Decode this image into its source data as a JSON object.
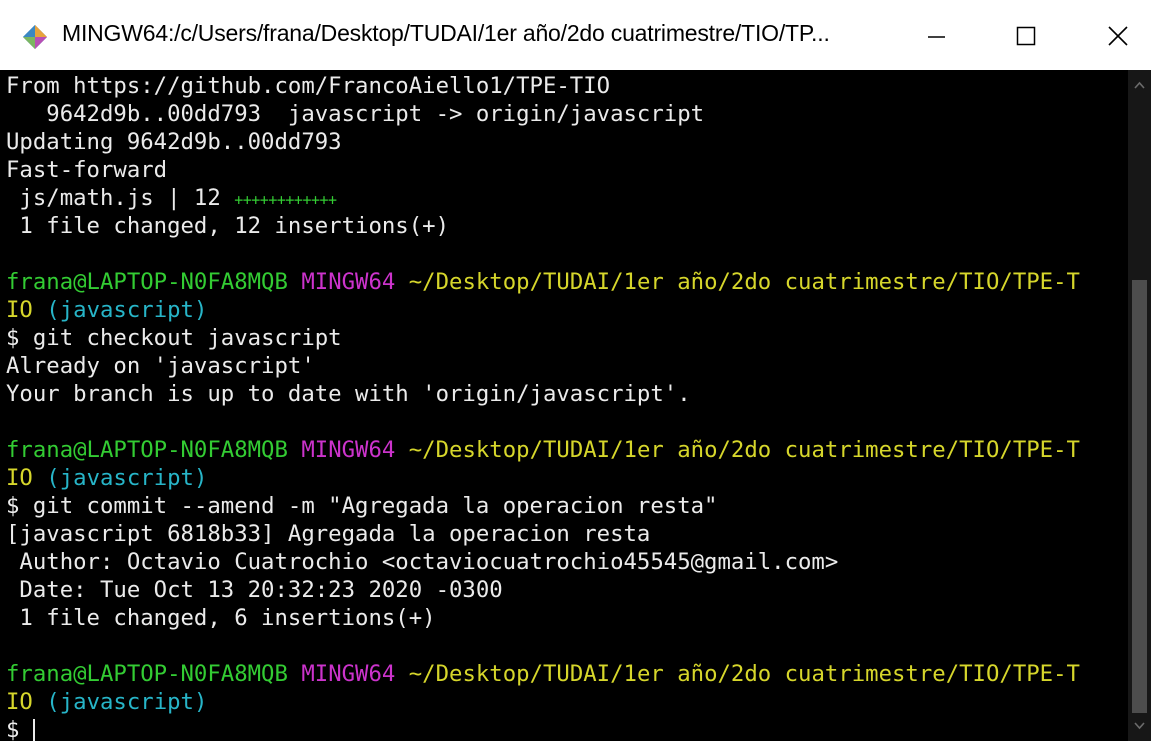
{
  "window": {
    "title": "MINGW64:/c/Users/frana/Desktop/TUDAI/1er año/2do cuatrimestre/TIO/TP...",
    "app_icon": "mingw-diamond-icon",
    "controls": {
      "minimize_icon": "minimize-icon",
      "maximize_icon": "maximize-icon",
      "close_icon": "close-icon"
    }
  },
  "colors": {
    "background": "#000000",
    "text": "#ebebeb",
    "user_host": "#33cc33",
    "mingw": "#cc33cc",
    "path": "#d6d62b",
    "branch": "#27b5c8"
  },
  "terminal": {
    "fetch": {
      "from": "From https://github.com/FrancoAiello1/TPE-TIO",
      "ref_update": "   9642d9b..00dd793  javascript -> origin/javascript",
      "updating": "Updating 9642d9b..00dd793",
      "fast_forward": "Fast-forward",
      "file_stat_name": " js/math.js | 12 ",
      "file_stat_plus": "++++++++++++",
      "summary": " 1 file changed, 12 insertions(+)"
    },
    "prompt": {
      "user_host": "frana@LAPTOP-N0FA8MQB",
      "mingw": "MINGW64",
      "path": "~/Desktop/TUDAI/1er año/2do cuatrimestre/TIO/TPE-T",
      "path_cont": "IO",
      "branch": "(javascript)",
      "symbol": "$ "
    },
    "checkout": {
      "command": "git checkout javascript",
      "out1": "Already on 'javascript'",
      "out2": "Your branch is up to date with 'origin/javascript'."
    },
    "commit": {
      "command": "git commit --amend -m \"Agregada la operacion resta\"",
      "out1": "[javascript 6818b33] Agregada la operacion resta",
      "author": " Author: Octavio Cuatrochio <octaviocuatrochio45545@gmail.com>",
      "date": " Date: Tue Oct 13 20:32:23 2020 -0300",
      "summary": " 1 file changed, 6 insertions(+)"
    }
  }
}
